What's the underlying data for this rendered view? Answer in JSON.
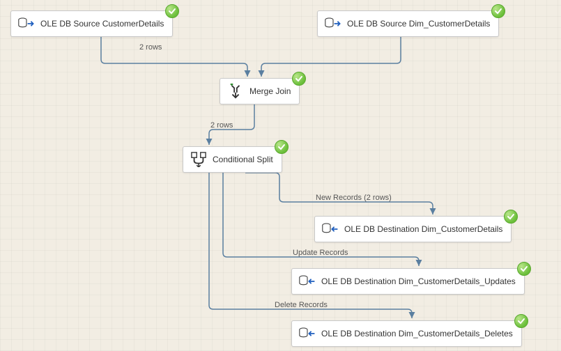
{
  "nodes": {
    "src1": {
      "label": "OLE DB Source CustomerDetails"
    },
    "src2": {
      "label": "OLE DB Source Dim_CustomerDetails"
    },
    "merge": {
      "label": "Merge Join"
    },
    "split": {
      "label": "Conditional Split"
    },
    "destNew": {
      "label": "OLE DB Destination Dim_CustomerDetails"
    },
    "destUpd": {
      "label": "OLE DB Destination Dim_CustomerDetails_Updates"
    },
    "destDel": {
      "label": "OLE DB Destination Dim_CustomerDetails_Deletes"
    }
  },
  "edges": {
    "src1_merge": {
      "label": "2 rows"
    },
    "merge_split": {
      "label": "2 rows"
    },
    "split_destNew": {
      "label": "New Records (2 rows)"
    },
    "split_destUpd": {
      "label": "Update Records"
    },
    "split_destDel": {
      "label": "Delete Records"
    }
  }
}
